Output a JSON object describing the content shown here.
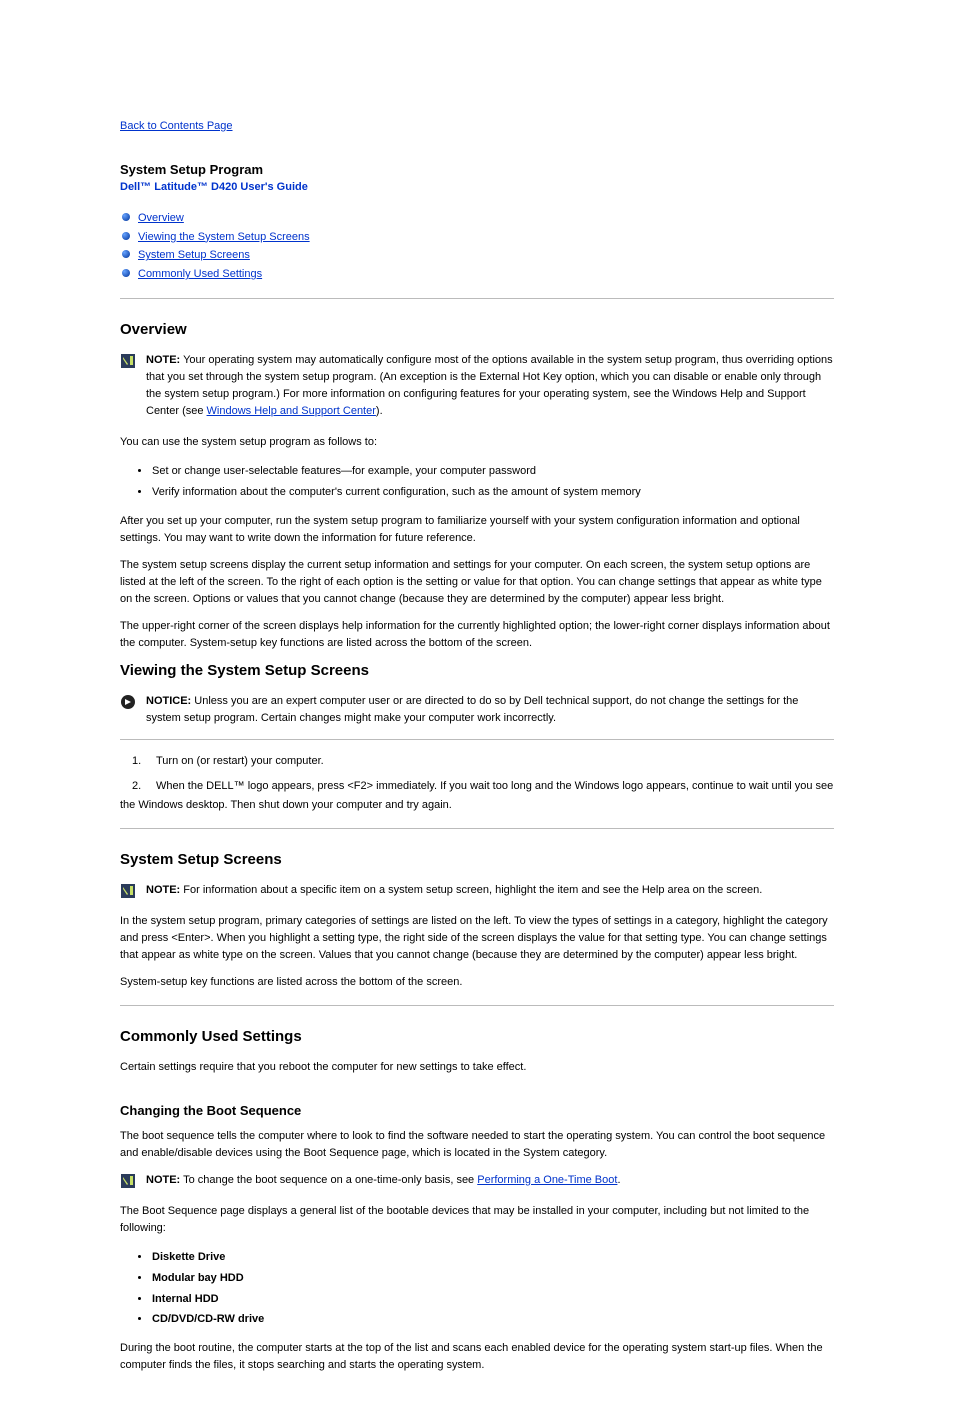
{
  "backLink": "Back to Contents Page",
  "sectionTitle": "System Setup Program",
  "docTitle": "Dell™ Latitude™ D420 User's Guide",
  "toc": [
    "Overview",
    "Viewing the System Setup Screens",
    "System Setup Screens",
    "Commonly Used Settings"
  ],
  "overviewHeading": "Overview",
  "note1": {
    "label": "NOTE:",
    "text": " Your operating system may automatically configure most of the options available in the system setup program, thus overriding options that you set through the system setup program. (An exception is the External Hot Key option, which you can disable or enable only through the system setup program.) For more information on configuring features for your operating system, see the Windows Help and Support Center (see ",
    "link": "Windows Help and Support Center",
    "after": ")."
  },
  "useIntro": "You can use the system setup program as follows to:",
  "useList": [
    "Set or change user-selectable features—for example, your computer password",
    "Verify information about the computer's current configuration, such as the amount of system memory"
  ],
  "afterSetup": "After you set up your computer, run the system setup program to familiarize yourself with your system configuration information and optional settings. You may want to write down the information for future reference.",
  "screensDesc": "The system setup screens display the current setup information and settings for your computer. On each screen, the system setup options are listed at the left of the screen. To the right of each option is the setting or value for that option. You can change settings that appear as white type on the screen. Options or values that you cannot change (because they are determined by the computer) appear less bright.",
  "screensDesc2": "The upper-right corner of the screen displays help information for the currently highlighted option; the lower-right corner displays information about the computer. System-setup key functions are listed across the bottom of the screen.",
  "viewingHeading": "Viewing the System Setup Screens",
  "notice": {
    "label": "NOTICE:",
    "text": " Unless you are an expert computer user or are directed to do so by Dell technical support, do not change the settings for the system setup program. Certain changes might make your computer work incorrectly."
  },
  "steps": [
    {
      "num": "1.",
      "text": "Turn on (or restart) your computer."
    },
    {
      "num": "2.",
      "text": "When the DELL™ logo appears, press <F2> immediately. If you wait too long and the Windows logo appears, continue to wait until you see the Windows desktop. Then shut down your computer and try again."
    }
  ],
  "sysScreensHeading": "System Setup Screens",
  "note2": {
    "label": "NOTE:",
    "text": " For information about a specific item on a system setup screen, highlight the item and see the Help area on the screen."
  },
  "sysScreensPara1": "In the system setup program, primary categories of settings are listed on the left. To view the types of settings in a category, highlight the category and press <Enter>. When you highlight a setting type, the right side of the screen displays the value for that setting type. You can change settings that appear as white type on the screen. Values that you cannot change (because they are determined by the computer) appear less bright.",
  "sysScreensPara2": "System-setup key functions are listed across the bottom of the screen.",
  "commonHeading": "Commonly Used Settings",
  "commonPara": "Certain settings require that you reboot the computer for new settings to take effect.",
  "bootSeqHeading": "Changing the Boot Sequence",
  "bootSeqPara": "The boot sequence tells the computer where to look to find the software needed to start the operating system. You can control the boot sequence and enable/disable devices using the Boot Sequence page, which is located in the System category.",
  "note3": {
    "label": "NOTE:",
    "text": " To change the boot sequence on a one-time-only basis, see ",
    "link": "Performing a One-Time Boot",
    "after": "."
  },
  "bootSeqPara2": "The Boot Sequence page displays a general list of the bootable devices that may be installed in your computer, including but not limited to the following:",
  "devices": [
    "Diskette Drive",
    "Modular bay HDD",
    "Internal HDD",
    "CD/DVD/CD-RW drive"
  ],
  "bootRoutine": "During the boot routine, the computer starts at the top of the list and scans each enabled device for the operating system start-up files. When the computer finds the files, it stops searching and starts the operating system."
}
